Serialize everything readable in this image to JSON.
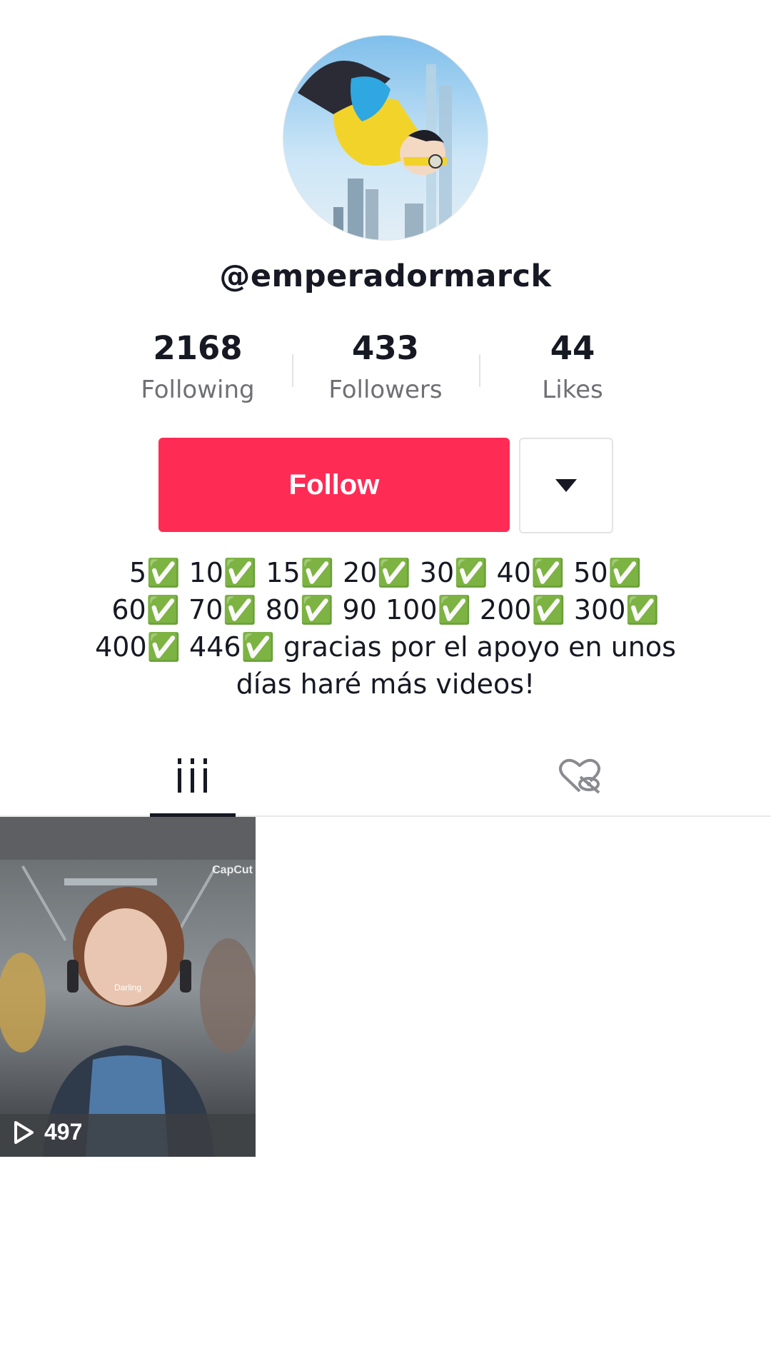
{
  "profile": {
    "username": "@emperadormarck",
    "avatar_icon": "animated-hero-avatar"
  },
  "stats": [
    {
      "value": "2168",
      "label": "Following"
    },
    {
      "value": "433",
      "label": "Followers"
    },
    {
      "value": "44",
      "label": "Likes"
    }
  ],
  "actions": {
    "follow_label": "Follow",
    "more_icon": "caret-down-icon"
  },
  "bio": {
    "line1": "5✅ 10✅ 15✅ 20✅ 30✅ 40✅ 50✅",
    "line2": "60✅ 70✅ 80✅ 90 100✅ 200✅ 300✅",
    "line3": "400✅ 446✅ gracias por el apoyo en unos",
    "line4": "días haré más videos!"
  },
  "tabs": [
    {
      "icon": "videos-grid-icon",
      "active": true
    },
    {
      "icon": "liked-private-icon",
      "active": false
    }
  ],
  "videos": [
    {
      "views": "497",
      "watermark": "CapCut",
      "caption": "Darling"
    }
  ],
  "colors": {
    "accent": "#fe2c55",
    "text": "#161823",
    "muted": "#6f7075"
  }
}
